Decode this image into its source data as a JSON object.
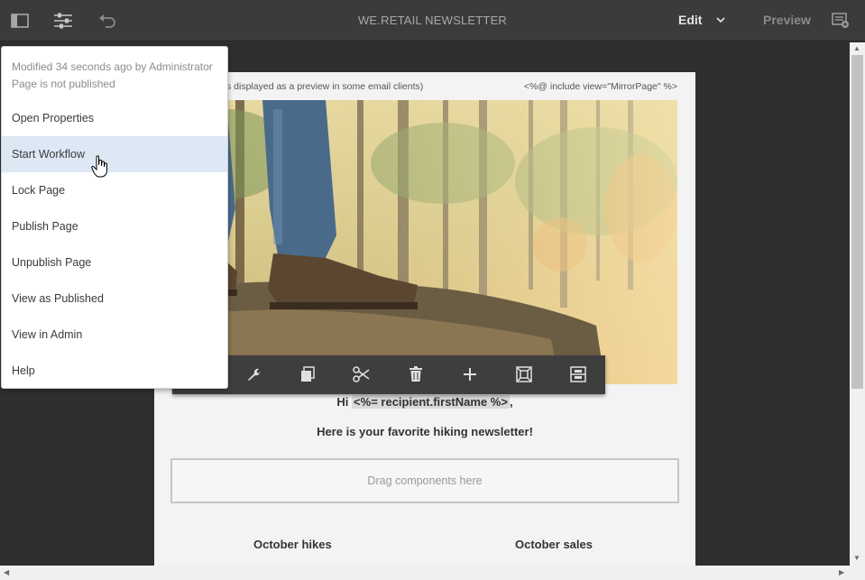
{
  "header": {
    "title": "WE.RETAIL NEWSLETTER",
    "edit_label": "Edit",
    "preview_label": "Preview"
  },
  "page_menu": {
    "modified": "Modified 34 seconds ago by Administrator",
    "status": "Page is not published",
    "items": [
      {
        "label": "Open Properties"
      },
      {
        "label": "Start Workflow"
      },
      {
        "label": "Lock Page"
      },
      {
        "label": "Publish Page"
      },
      {
        "label": "Unpublish Page"
      },
      {
        "label": "View as Published"
      },
      {
        "label": "View in Admin"
      },
      {
        "label": "Help"
      }
    ]
  },
  "email": {
    "preheader_left": "s displayed as a preview in some email clients)",
    "preheader_right": "<%@ include view=\"MirrorPage\" %>",
    "greeting_prefix": "Hi ",
    "greeting_tag": "<%= recipient.firstName %>",
    "greeting_suffix": ",",
    "subtitle": "Here is your favorite hiking newsletter!",
    "dropzone": "Drag components here",
    "col_left_title": "October hikes",
    "col_right_title": "October sales"
  },
  "toolbar_icons": [
    "wrench-icon",
    "copy-icon",
    "cut-icon",
    "trash-icon",
    "plus-icon",
    "frame-icon",
    "group-icon"
  ]
}
